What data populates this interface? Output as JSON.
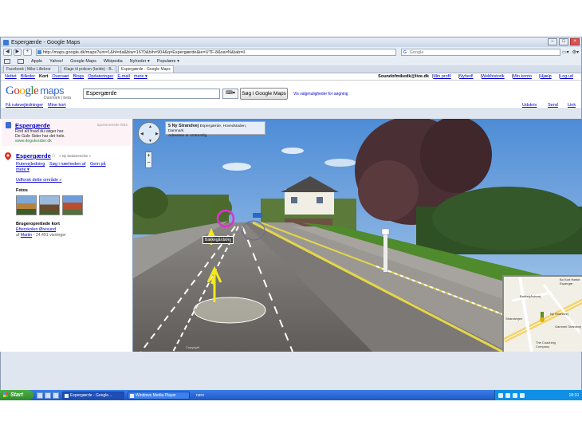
{
  "window": {
    "title": "Espergærde - Google Maps"
  },
  "browser": {
    "url": "http://maps.google.dk/maps?um=1&hl=da&biw=1670&bih=904&q=Espergærde&ie=UTF-8&sa=N&tab=il",
    "search_placeholder": "Google",
    "bookmarks": [
      "Apple",
      "Yahoo!",
      "Google Maps",
      "Wikipedia",
      "Nyheder ▾",
      "Populære ▾"
    ],
    "tabs": [
      "Facebook | Mike Lillebror",
      "Klage til policen (beide) - B...",
      "Espergærde - Google Maps"
    ]
  },
  "gbar": {
    "left": [
      "Nettet",
      "Billeder",
      "Kort",
      "Oversæt",
      "Blogs",
      "Opdateringer",
      "E-mail",
      "mere ▾"
    ],
    "active": "Kort",
    "user": "Soundofmikedk@live.dk",
    "right": [
      "Min profil",
      "Nyhed!",
      "Webhistorik",
      "Min konto",
      "Hjælp",
      "Log ud"
    ]
  },
  "header": {
    "logo_sub": "Danmark | beta",
    "query": "Espergærde",
    "search_button": "Søg i Google Maps",
    "options_link": "Vis valgmuligheder for søgning"
  },
  "linkbar": {
    "directions": "Få rutevejledninger",
    "my_maps": "Mine kort",
    "print": "Udskriv",
    "send": "Send",
    "link": "Link"
  },
  "ad": {
    "title": "Espergærde",
    "desc1": "Find alt hvad du søger her.",
    "desc2": "De Gule Sider har det hele.",
    "url": "www.degulesider.dk",
    "sponsor": "Sponsorerede links"
  },
  "result": {
    "title": "Espergærde",
    "new_rating": "« Ny bedømmelse »",
    "links": [
      "Rutevejledning",
      "Søg i nærheden af",
      "Gem på",
      "mere ▾"
    ],
    "explore": "Udforsk dette område »",
    "photos_label": "Fotos",
    "user_maps_label": "Brugeroprettede kort",
    "user_map": "Efterskolen Øresund",
    "user_meta_prefix": "af",
    "user_meta_author": "Martin",
    "user_meta_suffix": "- 24.491 visninger"
  },
  "streetview": {
    "address_title": "5 Ny Strandvej",
    "address_line1": "Espergærde, Hovedstaden, Danmark",
    "address_line2": "Adressen er omtrentlig",
    "street_label": "Bakkegårdsvej",
    "copyright": "Copyright",
    "map_labels": {
      "a": "Bakkegårdsvej",
      "b": "Strandvejen",
      "c": "Ny Strandvej",
      "d": "Gammel Strandvej",
      "e": "The Coaching Company",
      "f": "Bo Kort Hørkir Espergæ"
    }
  },
  "taskbar": {
    "start": "Start",
    "tasks": [
      "Espergærde - Google...",
      "Windows Media Player"
    ],
    "nero": "nero",
    "clock": "18:10"
  },
  "colors": {
    "link": "#0000cc",
    "accent": "#3b6dd1",
    "ad_bg": "#fdf3f7"
  }
}
